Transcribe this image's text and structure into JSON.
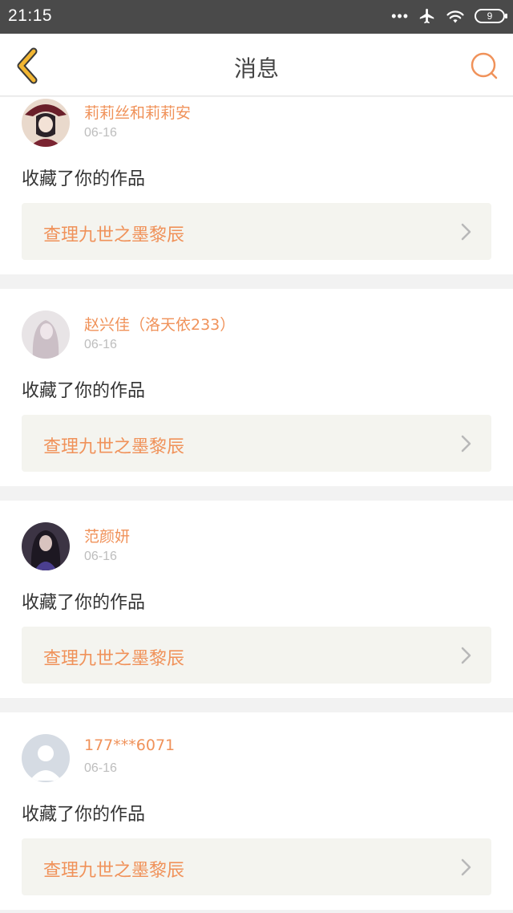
{
  "status_bar": {
    "time": "21:15",
    "signal_dots": "•••",
    "battery": "9"
  },
  "nav": {
    "title": "消息"
  },
  "messages": [
    {
      "username": "莉莉丝和莉莉安",
      "date": "06-16",
      "action": "收藏了你的作品",
      "work_title": "查理九世之墨黎辰"
    },
    {
      "username": "赵兴佳（洛天依233）",
      "date": "06-16",
      "action": "收藏了你的作品",
      "work_title": "查理九世之墨黎辰"
    },
    {
      "username": "范颜妍",
      "date": "06-16",
      "action": "收藏了你的作品",
      "work_title": "查理九世之墨黎辰"
    },
    {
      "username": "177***6071",
      "date": "06-16",
      "action": "收藏了你的作品",
      "work_title": "查理九世之墨黎辰"
    }
  ],
  "colors": {
    "accent": "#f0925a",
    "back_arrow": "#f2b632",
    "card_link_bg": "#f4f4ef",
    "status_bar": "#4a4a4a"
  }
}
